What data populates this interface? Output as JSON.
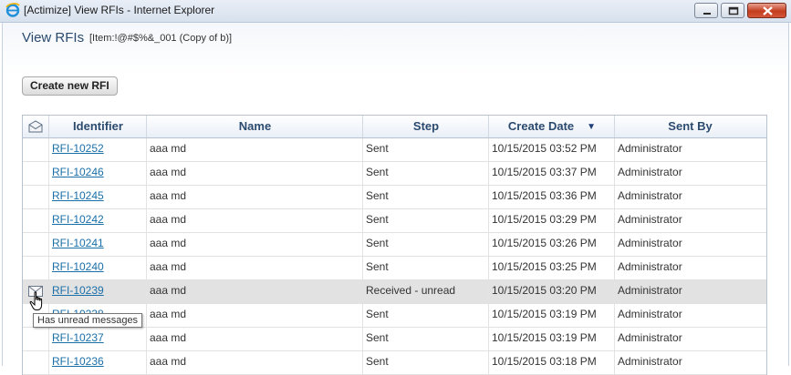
{
  "window": {
    "title": "[Actimize] View RFIs - Internet Explorer",
    "app_icon": "internet-explorer-icon"
  },
  "page": {
    "title": "View RFIs",
    "subtitle": "[Item:!@#$%&_001 (Copy of b)]"
  },
  "toolbar": {
    "create_label": "Create new RFI"
  },
  "table": {
    "columns": {
      "identifier": "Identifier",
      "name": "Name",
      "step": "Step",
      "create_date": "Create Date",
      "sent_by": "Sent By"
    },
    "sort": {
      "column": "Create Date",
      "direction": "descending"
    },
    "rows": [
      {
        "id": "RFI-10252",
        "name": "aaa md",
        "step": "Sent",
        "date": "10/15/2015 03:52 PM",
        "sent_by": "Administrator",
        "unread": false
      },
      {
        "id": "RFI-10246",
        "name": "aaa md",
        "step": "Sent",
        "date": "10/15/2015 03:37 PM",
        "sent_by": "Administrator",
        "unread": false
      },
      {
        "id": "RFI-10245",
        "name": "aaa md",
        "step": "Sent",
        "date": "10/15/2015 03:36 PM",
        "sent_by": "Administrator",
        "unread": false
      },
      {
        "id": "RFI-10242",
        "name": "aaa md",
        "step": "Sent",
        "date": "10/15/2015 03:29 PM",
        "sent_by": "Administrator",
        "unread": false
      },
      {
        "id": "RFI-10241",
        "name": "aaa md",
        "step": "Sent",
        "date": "10/15/2015 03:26 PM",
        "sent_by": "Administrator",
        "unread": false
      },
      {
        "id": "RFI-10240",
        "name": "aaa md",
        "step": "Sent",
        "date": "10/15/2015 03:25 PM",
        "sent_by": "Administrator",
        "unread": false
      },
      {
        "id": "RFI-10239",
        "name": "aaa md",
        "step": "Received - unread",
        "date": "10/15/2015 03:20 PM",
        "sent_by": "Administrator",
        "unread": true
      },
      {
        "id": "RFI-10238",
        "name": "aaa md",
        "step": "Sent",
        "date": "10/15/2015 03:19 PM",
        "sent_by": "Administrator",
        "unread": false
      },
      {
        "id": "RFI-10237",
        "name": "aaa md",
        "step": "Sent",
        "date": "10/15/2015 03:19 PM",
        "sent_by": "Administrator",
        "unread": false
      },
      {
        "id": "RFI-10236",
        "name": "aaa md",
        "step": "Sent",
        "date": "10/15/2015 03:18 PM",
        "sent_by": "Administrator",
        "unread": false
      }
    ]
  },
  "tooltip": {
    "text": "Has unread messages"
  },
  "colors": {
    "header_text": "#2b4a6f",
    "link": "#1a6fa8",
    "highlight_row": "#e2e2e2"
  }
}
